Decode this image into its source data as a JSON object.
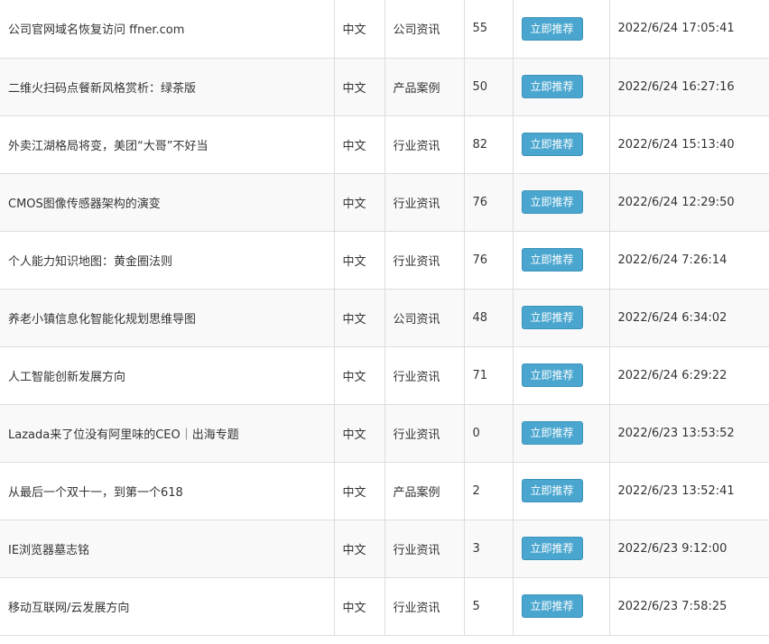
{
  "button_label": "立即推荐",
  "colors": {
    "button": "#4aa6cf",
    "border": "#dddddd",
    "text": "#333333",
    "row_alt": "#f9f9f9"
  },
  "rows": [
    {
      "title": "公司官网域名恢复访问 ffner.com",
      "lang": "中文",
      "category": "公司资讯",
      "views": "55",
      "time": "2022/6/24 17:05:41"
    },
    {
      "title": "二维火扫码点餐新风格赏析：绿茶版",
      "lang": "中文",
      "category": "产品案例",
      "views": "50",
      "time": "2022/6/24 16:27:16"
    },
    {
      "title": "外卖江湖格局将变，美团“大哥”不好当",
      "lang": "中文",
      "category": "行业资讯",
      "views": "82",
      "time": "2022/6/24 15:13:40"
    },
    {
      "title": "CMOS图像传感器架构的演变",
      "lang": "中文",
      "category": "行业资讯",
      "views": "76",
      "time": "2022/6/24 12:29:50"
    },
    {
      "title": "个人能力知识地图：黄金圈法则",
      "lang": "中文",
      "category": "行业资讯",
      "views": "76",
      "time": "2022/6/24 7:26:14"
    },
    {
      "title": "养老小镇信息化智能化规划思维导图",
      "lang": "中文",
      "category": "公司资讯",
      "views": "48",
      "time": "2022/6/24 6:34:02"
    },
    {
      "title": "人工智能创新发展方向",
      "lang": "中文",
      "category": "行业资讯",
      "views": "71",
      "time": "2022/6/24 6:29:22"
    },
    {
      "title": "Lazada来了位没有阿里味的CEO｜出海专题",
      "lang": "中文",
      "category": "行业资讯",
      "views": "0",
      "time": "2022/6/23 13:53:52"
    },
    {
      "title": "从最后一个双十一，到第一个618",
      "lang": "中文",
      "category": "产品案例",
      "views": "2",
      "time": "2022/6/23 13:52:41"
    },
    {
      "title": "IE浏览器墓志铭",
      "lang": "中文",
      "category": "行业资讯",
      "views": "3",
      "time": "2022/6/23 9:12:00"
    },
    {
      "title": "移动互联网/云发展方向",
      "lang": "中文",
      "category": "行业资讯",
      "views": "5",
      "time": "2022/6/23 7:58:25"
    }
  ]
}
